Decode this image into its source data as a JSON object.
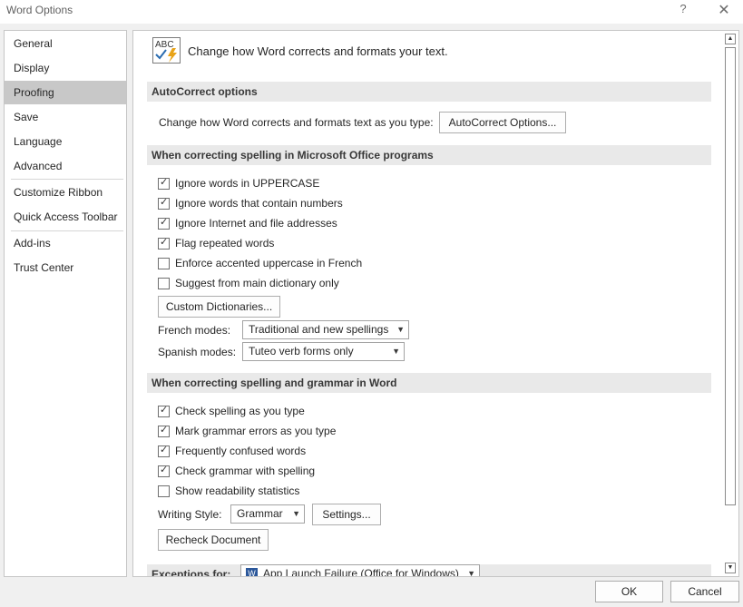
{
  "window": {
    "title": "Word Options",
    "help_label": "?",
    "close_label": "✕"
  },
  "sidebar": {
    "items": [
      {
        "label": "General"
      },
      {
        "label": "Display"
      },
      {
        "label": "Proofing",
        "selected": true
      },
      {
        "label": "Save"
      },
      {
        "label": "Language"
      },
      {
        "label": "Advanced"
      },
      {
        "label": "Customize Ribbon"
      },
      {
        "label": "Quick Access Toolbar"
      },
      {
        "label": "Add-ins"
      },
      {
        "label": "Trust Center"
      }
    ]
  },
  "header": {
    "icon_text": "ABC",
    "text": "Change how Word corrects and formats your text."
  },
  "autocorrect": {
    "heading": "AutoCorrect options",
    "description": "Change how Word corrects and formats text as you type:",
    "button": "AutoCorrect Options..."
  },
  "office_spelling": {
    "heading": "When correcting spelling in Microsoft Office programs",
    "options": [
      {
        "label": "Ignore words in UPPERCASE",
        "checked": true
      },
      {
        "label": "Ignore words that contain numbers",
        "checked": true
      },
      {
        "label": "Ignore Internet and file addresses",
        "checked": true
      },
      {
        "label": "Flag repeated words",
        "checked": true
      },
      {
        "label": "Enforce accented uppercase in French",
        "checked": false
      },
      {
        "label": "Suggest from main dictionary only",
        "checked": false
      }
    ],
    "custom_dictionaries_button": "Custom Dictionaries...",
    "french_modes_label": "French modes:",
    "french_modes_value": "Traditional and new spellings",
    "spanish_modes_label": "Spanish modes:",
    "spanish_modes_value": "Tuteo verb forms only"
  },
  "word_spelling": {
    "heading": "When correcting spelling and grammar in Word",
    "options": [
      {
        "label": "Check spelling as you type",
        "checked": true
      },
      {
        "label": "Mark grammar errors as you type",
        "checked": true
      },
      {
        "label": "Frequently confused words",
        "checked": true
      },
      {
        "label": "Check grammar with spelling",
        "checked": true
      },
      {
        "label": "Show readability statistics",
        "checked": false
      }
    ],
    "writing_style_label": "Writing Style:",
    "writing_style_value": "Grammar",
    "settings_button": "Settings...",
    "recheck_button": "Recheck Document"
  },
  "exceptions": {
    "label": "Exceptions for:",
    "document_value": "App Launch Failure (Office for Windows)"
  },
  "footer": {
    "ok": "OK",
    "cancel": "Cancel"
  },
  "colors": {
    "selected_nav": "#c8c8c8",
    "section_bg": "#e9e9e9",
    "dialog_bg": "#f0f0f0",
    "icon_blue": "#2b6cb0",
    "icon_gold": "#e8a317"
  }
}
